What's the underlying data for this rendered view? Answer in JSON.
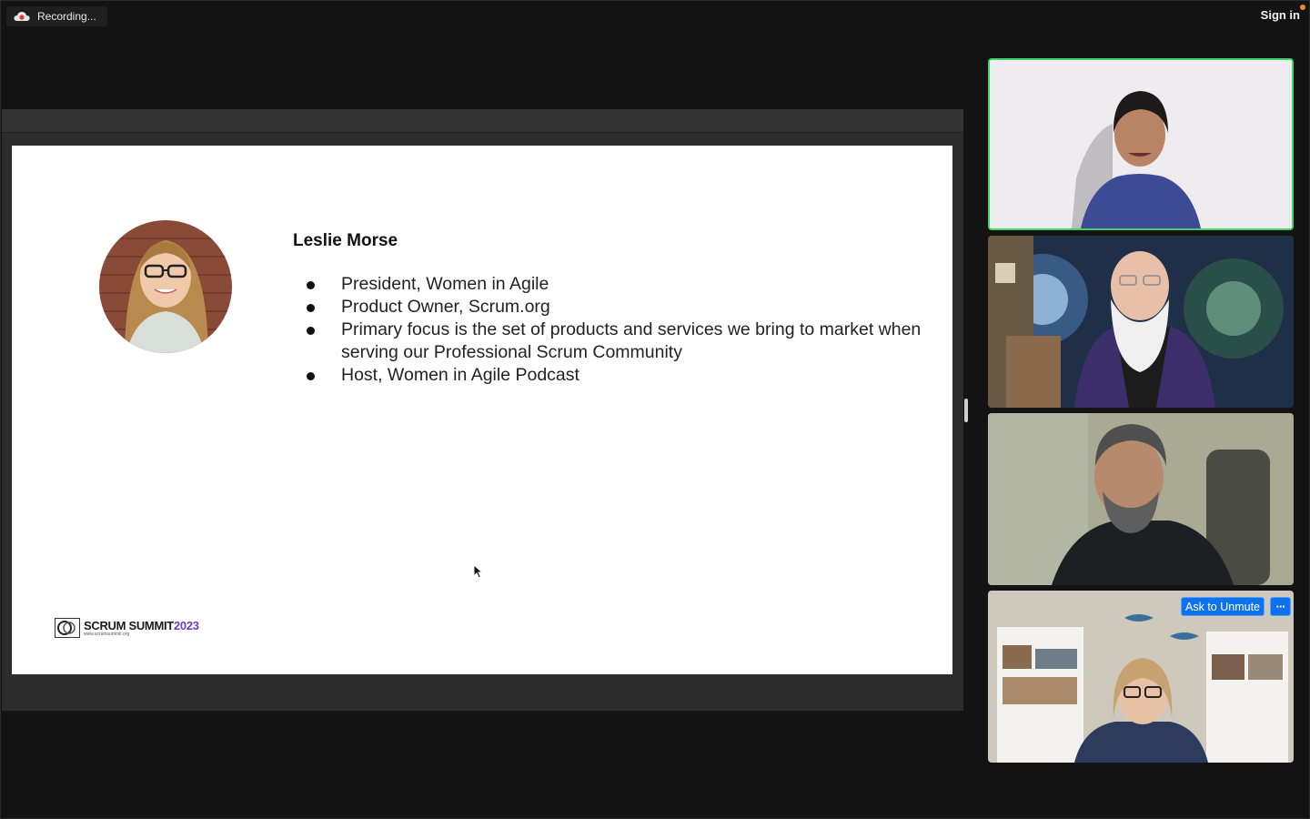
{
  "header": {
    "recording_label": "Recording...",
    "sign_in_label": "Sign in"
  },
  "slide": {
    "speaker_name": "Leslie Morse",
    "bullets": [
      "President, Women in Agile",
      "Product Owner, Scrum.org",
      "Primary focus is the set of products and services we bring to market when serving our Professional Scrum Community",
      "Host, Women in Agile Podcast"
    ],
    "logo": {
      "main": "SCRUM SUMMIT",
      "year": "2023",
      "url": "www.scrumsummit.org"
    }
  },
  "participants": {
    "tile4": {
      "ask_unmute_label": "Ask to Unmute",
      "more_label": "···"
    }
  },
  "colors": {
    "background": "#131313",
    "active_speaker_border": "#3fd46a",
    "zoom_blue": "#0e72ed",
    "logo_purple": "#6a3fc2",
    "notify_dot": "#f08a24"
  },
  "icons": {
    "recording": "cloud-recording-icon",
    "cursor": "mouse-pointer-icon",
    "logo_mark": "scrum-summit-logo-mark"
  }
}
